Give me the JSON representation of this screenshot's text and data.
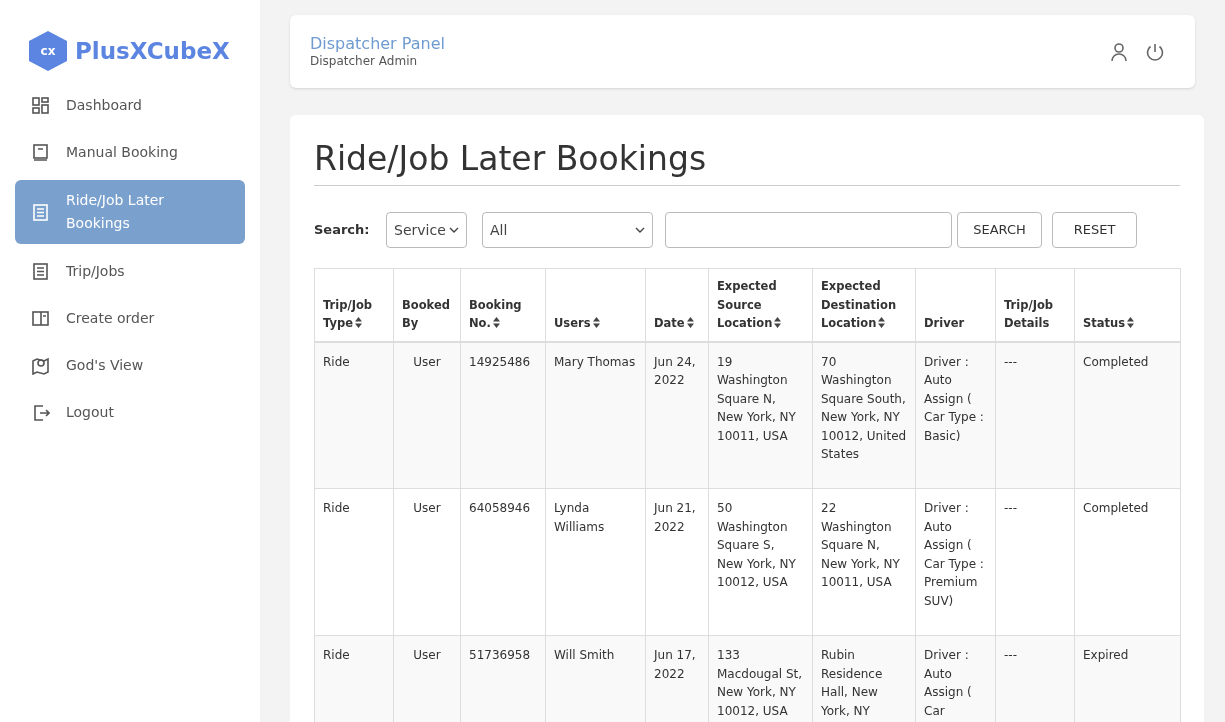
{
  "brand": {
    "logo_text": "cx",
    "name": "PlusXCubeX"
  },
  "sidebar": {
    "items": [
      {
        "label": "Dashboard",
        "selected": false
      },
      {
        "label": "Manual Booking",
        "selected": false
      },
      {
        "label": "Ride/Job Later Bookings",
        "selected": true
      },
      {
        "label": "Trip/Jobs",
        "selected": false
      },
      {
        "label": "Create order",
        "selected": false
      },
      {
        "label": "God's View",
        "selected": false
      },
      {
        "label": "Logout",
        "selected": false
      }
    ]
  },
  "header": {
    "title": "Dispatcher Panel",
    "subtitle": "Dispatcher Admin"
  },
  "page_title": "Ride/Job Later Bookings",
  "search": {
    "label": "Search:",
    "service_select": "Service",
    "filter_select": "All",
    "buttons": [
      "SEARCH",
      "RESET"
    ]
  },
  "table": {
    "columns": [
      {
        "label": "Trip/Job Type",
        "sortable": true
      },
      {
        "label": "Booked By",
        "sortable": false
      },
      {
        "label": "Booking No.",
        "sortable": true
      },
      {
        "label": "Users",
        "sortable": true
      },
      {
        "label": "Date",
        "sortable": true
      },
      {
        "label": "Expected Source Location",
        "sortable": true
      },
      {
        "label": "Expected Destination Location",
        "sortable": true
      },
      {
        "label": "Driver",
        "sortable": false
      },
      {
        "label": "Trip/Job Details",
        "sortable": false
      },
      {
        "label": "Status",
        "sortable": true
      }
    ],
    "rows": [
      [
        "Ride",
        "User",
        "14925486",
        "Mary Thomas",
        "Jun 24, 2022",
        "19 Washington Square N, New York, NY 10011, USA",
        "70 Washington Square South, New York, NY 10012, United States",
        "Driver : Auto Assign ( Car Type : Basic)",
        "---",
        "Completed"
      ],
      [
        "Ride",
        "User",
        "64058946",
        "Lynda Williams",
        "Jun 21, 2022",
        "50 Washington Square S, New York, NY 10012, USA",
        "22 Washington Square N, New York, NY 10011, USA",
        "Driver : Auto Assign ( Car Type : Premium SUV)",
        "---",
        "Completed"
      ],
      [
        "Ride",
        "User",
        "51736958",
        "Will Smith",
        "Jun 17, 2022",
        "133 Macdougal St, New York, NY 10012, USA",
        "Rubin Residence Hall, New York, NY",
        "Driver : Auto Assign ( Car",
        "---",
        "Expired"
      ]
    ]
  }
}
